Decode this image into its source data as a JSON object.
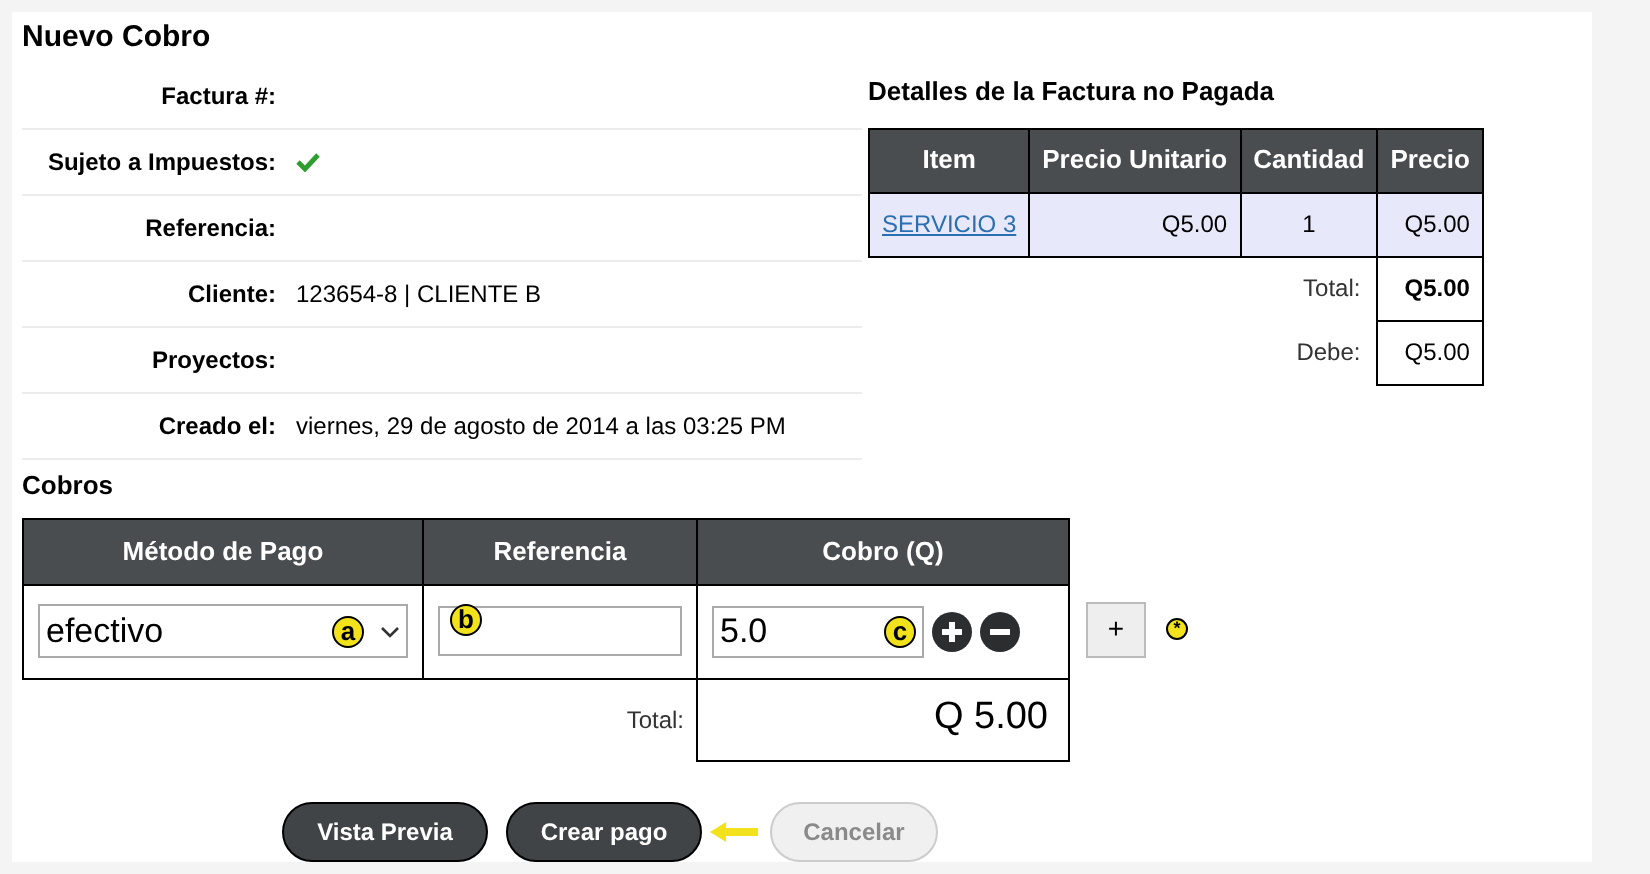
{
  "title": "Nuevo Cobro",
  "details": [
    {
      "label": "Factura #:",
      "kind": "text"
    },
    {
      "label": "Sujeto a Impuestos:",
      "kind": "check",
      "checked": true
    },
    {
      "label": "Referencia:",
      "kind": "text"
    },
    {
      "label": "Cliente:",
      "kind": "text",
      "value": "123654-8 | CLIENTE B"
    },
    {
      "label": "Proyectos:",
      "kind": "text"
    },
    {
      "label": "Creado el:",
      "kind": "text",
      "value": "viernes, 29 de agosto de 2014 a las 03:25 PM"
    }
  ],
  "invoice": {
    "title": "Detalles de la Factura no Pagada",
    "columns": [
      "Item",
      "Precio Unitario",
      "Cantidad",
      "Precio"
    ],
    "rows": [
      [
        "SERVICIO 3",
        "Q5.00",
        "1",
        "Q5.00"
      ]
    ],
    "summary": [
      {
        "label": "Total:",
        "value": "Q5.00",
        "bold": true
      },
      {
        "label": "Debe:",
        "value": "Q5.00",
        "bold": false
      }
    ]
  },
  "cobros": {
    "title": "Cobros",
    "columns": [
      "Método de Pago",
      "Referencia",
      "Cobro (Q)"
    ],
    "method": "efectivo",
    "amount": "5.0",
    "add": "+",
    "total_label": "Total:",
    "total": "Q 5.00"
  },
  "markers": [
    "a",
    "b",
    "c",
    "*"
  ],
  "buttons": [
    {
      "label": "Vista Previa",
      "disabled": false
    },
    {
      "label": "Crear pago",
      "disabled": false
    },
    {
      "label": "Cancelar",
      "disabled": true
    }
  ]
}
